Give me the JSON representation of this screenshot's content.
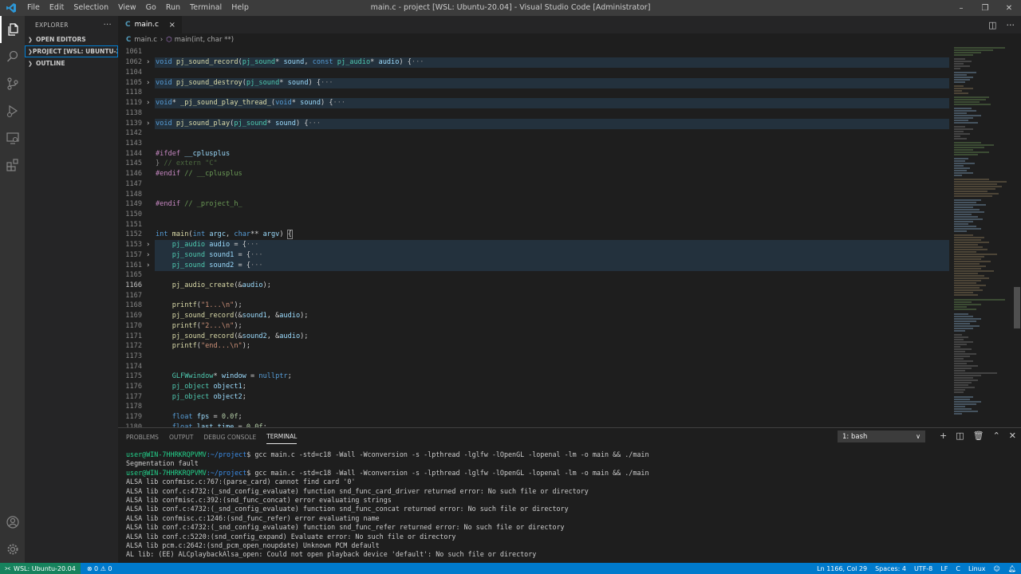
{
  "titlebar": {
    "menu": [
      "File",
      "Edit",
      "Selection",
      "View",
      "Go",
      "Run",
      "Terminal",
      "Help"
    ],
    "title": "main.c - project [WSL: Ubuntu-20.04] - Visual Studio Code [Administrator]"
  },
  "activitybar": [
    "explorer-icon",
    "search-icon",
    "source-control-icon",
    "run-debug-icon",
    "remote-explorer-icon",
    "extensions-icon",
    "account-icon",
    "settings-gear-icon"
  ],
  "sidebar": {
    "title": "EXPLORER",
    "more": "···",
    "sections": [
      {
        "label": "OPEN EDITORS"
      },
      {
        "label": "PROJECT [WSL: UBUNTU-2..."
      },
      {
        "label": "OUTLINE"
      }
    ]
  },
  "tab": {
    "icon": "C",
    "label": "main.c",
    "close": "×"
  },
  "breadcrumb": {
    "file_icon": "C",
    "file": "main.c",
    "symbol": "main(int, char **)"
  },
  "code": {
    "line_numbers": [
      "1061",
      "1062",
      "1104",
      "1105",
      "1118",
      "1119",
      "1138",
      "1139",
      "1142",
      "1143",
      "1144",
      "1145",
      "1146",
      "1147",
      "1148",
      "1149",
      "1150",
      "1151",
      "1152",
      "1153",
      "1157",
      "1161",
      "1165",
      "1166",
      "1167",
      "1168",
      "1169",
      "1170",
      "1171",
      "1172",
      "1173",
      "1174",
      "1175",
      "1176",
      "1177",
      "1178",
      "1179",
      "1180"
    ]
  },
  "panel": {
    "tabs": [
      "PROBLEMS",
      "OUTPUT",
      "DEBUG CONSOLE",
      "TERMINAL"
    ],
    "terminal_select": "1: bash",
    "prompt_user": "user@WIN-7HHRKRQPVMV",
    "prompt_path": ":~/project",
    "command": "$ gcc main.c -std=c18 -Wall -Wconversion -s -lpthread -lglfw -lOpenGL -lopenal -lm -o main && ./main",
    "lines": [
      "Segmentation fault",
      "ALSA lib confmisc.c:767:(parse_card) cannot find card '0'",
      "ALSA lib conf.c:4732:(_snd_config_evaluate) function snd_func_card_driver returned error: No such file or directory",
      "ALSA lib confmisc.c:392:(snd_func_concat) error evaluating strings",
      "ALSA lib conf.c:4732:(_snd_config_evaluate) function snd_func_concat returned error: No such file or directory",
      "ALSA lib confmisc.c:1246:(snd_func_refer) error evaluating name",
      "ALSA lib conf.c:4732:(_snd_config_evaluate) function snd_func_refer returned error: No such file or directory",
      "ALSA lib conf.c:5220:(snd_config_expand) Evaluate error: No such file or directory",
      "ALSA lib pcm.c:2642:(snd_pcm_open_noupdate) Unknown PCM default",
      "AL lib: (EE) ALCplaybackAlsa_open: Could not open playback device 'default': No such file or directory"
    ]
  },
  "statusbar": {
    "remote": "WSL: Ubuntu-20.04",
    "problems": "⊗ 0 ⚠ 0",
    "position": "Ln 1166, Col 29",
    "spaces": "Spaces: 4",
    "encoding": "UTF-8",
    "eol": "LF",
    "language": "C",
    "os": "Linux"
  }
}
